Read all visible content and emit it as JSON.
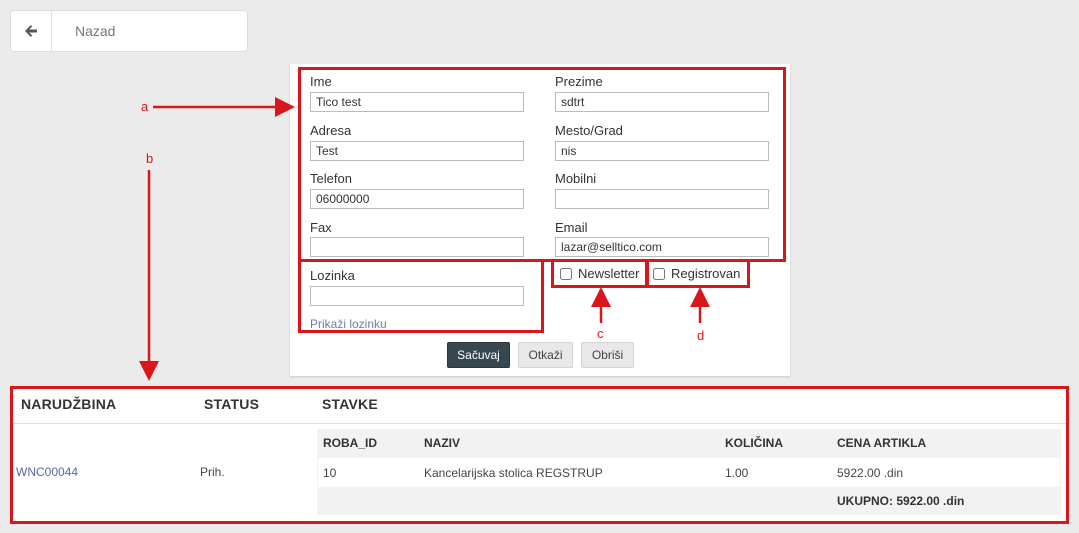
{
  "header": {
    "back_label": "Nazad",
    "back_icon": "arrow-left-icon"
  },
  "form": {
    "first_name": {
      "label": "Ime",
      "value": "Tico test"
    },
    "last_name": {
      "label": "Prezime",
      "value": "sdtrt"
    },
    "address": {
      "label": "Adresa",
      "value": "Test"
    },
    "city": {
      "label": "Mesto/Grad",
      "value": "nis"
    },
    "phone": {
      "label": "Telefon",
      "value": "06000000"
    },
    "mobile": {
      "label": "Mobilni",
      "value": ""
    },
    "fax": {
      "label": "Fax",
      "value": ""
    },
    "email": {
      "label": "Email",
      "value": "lazar@selltico.com"
    },
    "password": {
      "label": "Lozinka",
      "value": ""
    },
    "show_password": "Prikaži lozinku",
    "newsletter": {
      "label": "Newsletter",
      "checked": false
    },
    "registered": {
      "label": "Registrovan",
      "checked": false
    },
    "buttons": {
      "save": "Sačuvaj",
      "cancel": "Otkaži",
      "delete": "Obriši"
    }
  },
  "annotations": {
    "a": "a",
    "b": "b",
    "c": "c",
    "d": "d",
    "color": "#d9161c"
  },
  "orders": {
    "headers": {
      "order": "NARUDŽBINA",
      "status": "STATUS",
      "items": "STAVKE"
    },
    "rows": [
      {
        "order_id": "WNC00044",
        "status": "Prih.",
        "items_headers": {
          "id": "ROBA_ID",
          "name": "NAZIV",
          "qty": "KOLIČINA",
          "price": "CENA ARTIKLA"
        },
        "items": [
          {
            "id": "10",
            "name": "Kancelarijska stolica REGSTRUP",
            "qty": "1.00",
            "price": "5922.00 .din"
          }
        ],
        "total": "UKUPNO: 5922.00 .din"
      }
    ]
  }
}
